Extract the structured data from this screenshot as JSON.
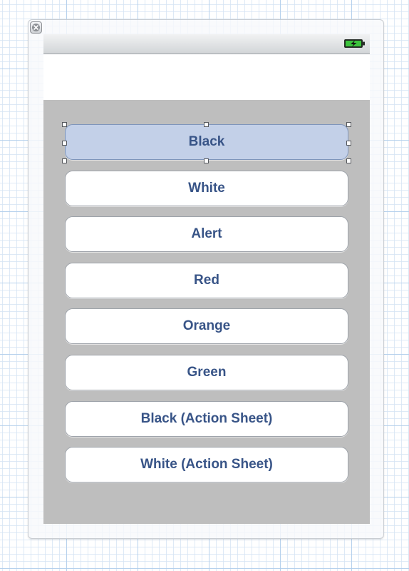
{
  "canvas": {
    "background_color": "#ffffff",
    "grid_color": "#b0cdeb"
  },
  "scene": {
    "close_icon": "close-x-icon"
  },
  "device": {
    "status_bar": {
      "battery_icon": "battery-charging-icon",
      "battery_color": "#3cc43c"
    },
    "screen_background": "#bebebe",
    "nav_area_background": "#ffffff"
  },
  "buttons": [
    {
      "label": "Black",
      "selected": true
    },
    {
      "label": "White",
      "selected": false
    },
    {
      "label": "Alert",
      "selected": false
    },
    {
      "label": "Red",
      "selected": false
    },
    {
      "label": "Orange",
      "selected": false
    },
    {
      "label": "Green",
      "selected": false
    },
    {
      "label": "Black (Action Sheet)",
      "selected": false
    },
    {
      "label": "White (Action Sheet)",
      "selected": false
    }
  ],
  "colors": {
    "button_text": "#385487",
    "button_selected_fill": "#c3d0e8",
    "button_fill": "#ffffff"
  }
}
